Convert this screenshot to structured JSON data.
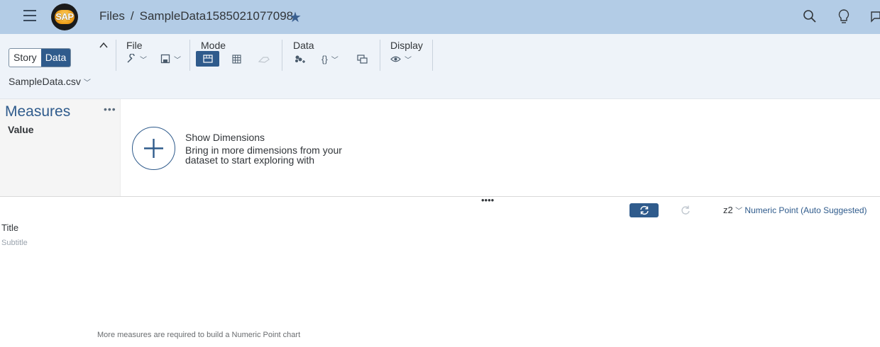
{
  "shell": {
    "breadcrumb_root": "Files",
    "breadcrumb_sep": "/",
    "document_name": "SampleData1585021077098",
    "logo_text": "SAP"
  },
  "toolbar": {
    "view_toggle": {
      "story": "Story",
      "data": "Data",
      "selected": "Data"
    },
    "groups": {
      "file": "File",
      "mode": "Mode",
      "data": "Data",
      "display": "Display"
    },
    "file_select": "SampleData.csv"
  },
  "measures": {
    "heading": "Measures",
    "more": "•••",
    "items": [
      "Value"
    ]
  },
  "dimensions": {
    "title": "Show Dimensions",
    "description": "Bring in more dimensions from your dataset to start exploring with"
  },
  "splitter_grip": "••••",
  "chart": {
    "type_number": "2",
    "type_prefix": "z",
    "type_label": "Numeric Point (Auto Suggested)",
    "title": "Title",
    "subtitle": "Subtitle",
    "message": "More measures are required to build a Numeric Point chart"
  },
  "colors": {
    "shell_bg": "#b3cce6",
    "accent": "#2f5b8c",
    "toolbar_bg": "#eef3f9"
  }
}
